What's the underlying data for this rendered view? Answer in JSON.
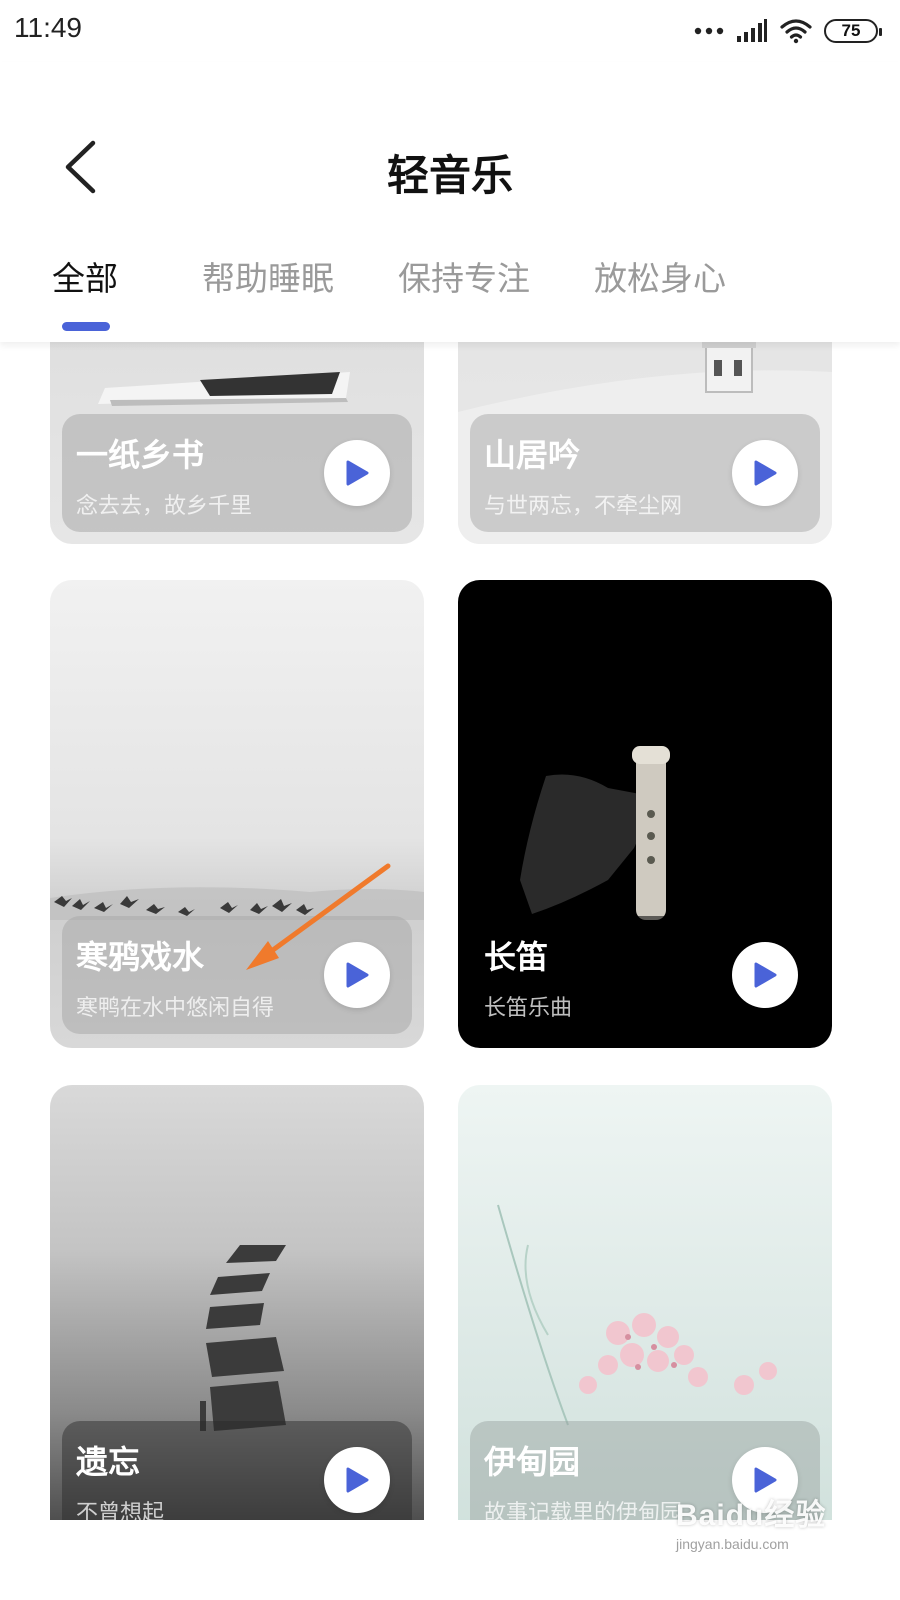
{
  "status_bar": {
    "time": "11:49",
    "battery": "75"
  },
  "header": {
    "title": "轻音乐"
  },
  "tabs": [
    {
      "label": "全部",
      "active": true
    },
    {
      "label": "帮助睡眠",
      "active": false
    },
    {
      "label": "保持专注",
      "active": false
    },
    {
      "label": "放松身心",
      "active": false
    }
  ],
  "cards": [
    {
      "title": "一纸乡书",
      "subtitle": "念去去，故乡千里"
    },
    {
      "title": "山居吟",
      "subtitle": "与世两忘，不牵尘网"
    },
    {
      "title": "寒鸦戏水",
      "subtitle": "寒鸭在水中悠闲自得"
    },
    {
      "title": "长笛",
      "subtitle": "长笛乐曲"
    },
    {
      "title": "遗忘",
      "subtitle": "不曾想起"
    },
    {
      "title": "伊甸园",
      "subtitle": "故事记载里的伊甸园"
    }
  ],
  "colors": {
    "accent": "#4a63d8",
    "arrow": "#f07a2c"
  },
  "watermark": {
    "logo": "Baidu经验",
    "url": "jingyan.baidu.com"
  }
}
